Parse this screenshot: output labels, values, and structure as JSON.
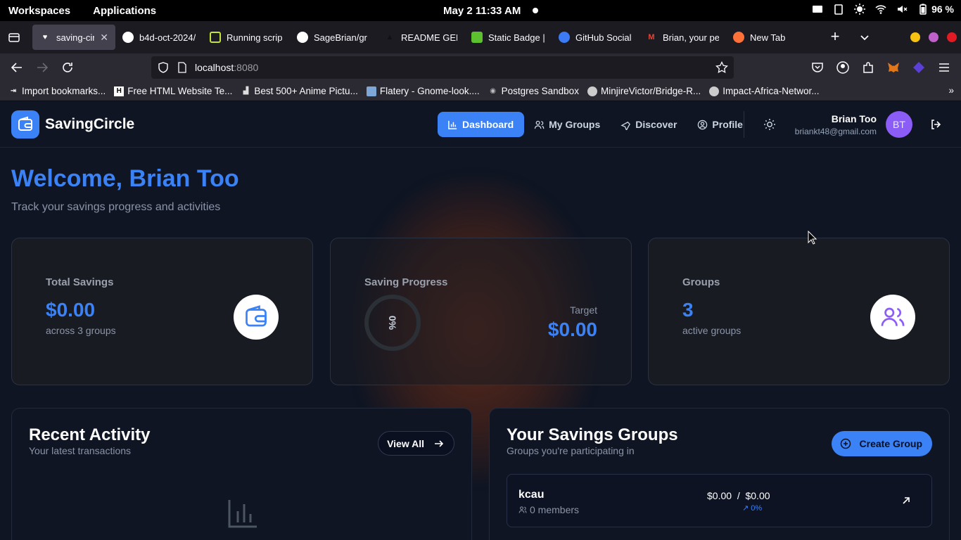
{
  "system": {
    "workspaces": "Workspaces",
    "applications": "Applications",
    "clock": "May 2  11:33 AM",
    "battery": "96 %"
  },
  "browser": {
    "tabs": [
      {
        "title": "saving-circle",
        "active": true
      },
      {
        "title": "b4d-oct-2024/"
      },
      {
        "title": "Running scrip"
      },
      {
        "title": "SageBrian/gr"
      },
      {
        "title": "README GEN"
      },
      {
        "title": "Static Badge |"
      },
      {
        "title": "GitHub Social"
      },
      {
        "title": "Brian, your pe"
      },
      {
        "title": "New Tab"
      }
    ],
    "url_host": "localhost",
    "url_port": ":8080",
    "bookmarks": [
      "Import bookmarks...",
      "Free HTML Website Te...",
      "Best 500+ Anime Pictu...",
      "Flatery - Gnome-look....",
      "Postgres Sandbox",
      "MinjireVictor/Bridge-R...",
      "Impact-Africa-Networ..."
    ]
  },
  "app": {
    "brand": "SavingCircle",
    "nav": {
      "dashboard": "Dashboard",
      "groups": "My Groups",
      "discover": "Discover",
      "profile": "Profile"
    },
    "user": {
      "name": "Brian Too",
      "email": "briankt48@gmail.com",
      "initials": "BT"
    },
    "welcome": "Welcome, Brian Too",
    "subtitle": "Track your savings progress and activities",
    "stats": {
      "total_label": "Total Savings",
      "total_value": "$0.00",
      "total_sub": "across 3 groups",
      "progress_label": "Saving Progress",
      "progress_percent": "0%",
      "target_label": "Target",
      "target_value": "$0.00",
      "groups_label": "Groups",
      "groups_value": "3",
      "groups_sub": "active groups"
    },
    "activity": {
      "title": "Recent Activity",
      "subtitle": "Your latest transactions",
      "view_all": "View All"
    },
    "groups_panel": {
      "title": "Your Savings Groups",
      "subtitle": "Groups you're participating in",
      "create": "Create Group",
      "items": [
        {
          "name": "kcau",
          "members": "0 members",
          "amount": "$0.00  /  $0.00",
          "percent": "0%"
        }
      ]
    }
  },
  "colors": {
    "accent": "#3b82f6",
    "avatar": "#8b5cf6",
    "background": "#0f1523"
  }
}
